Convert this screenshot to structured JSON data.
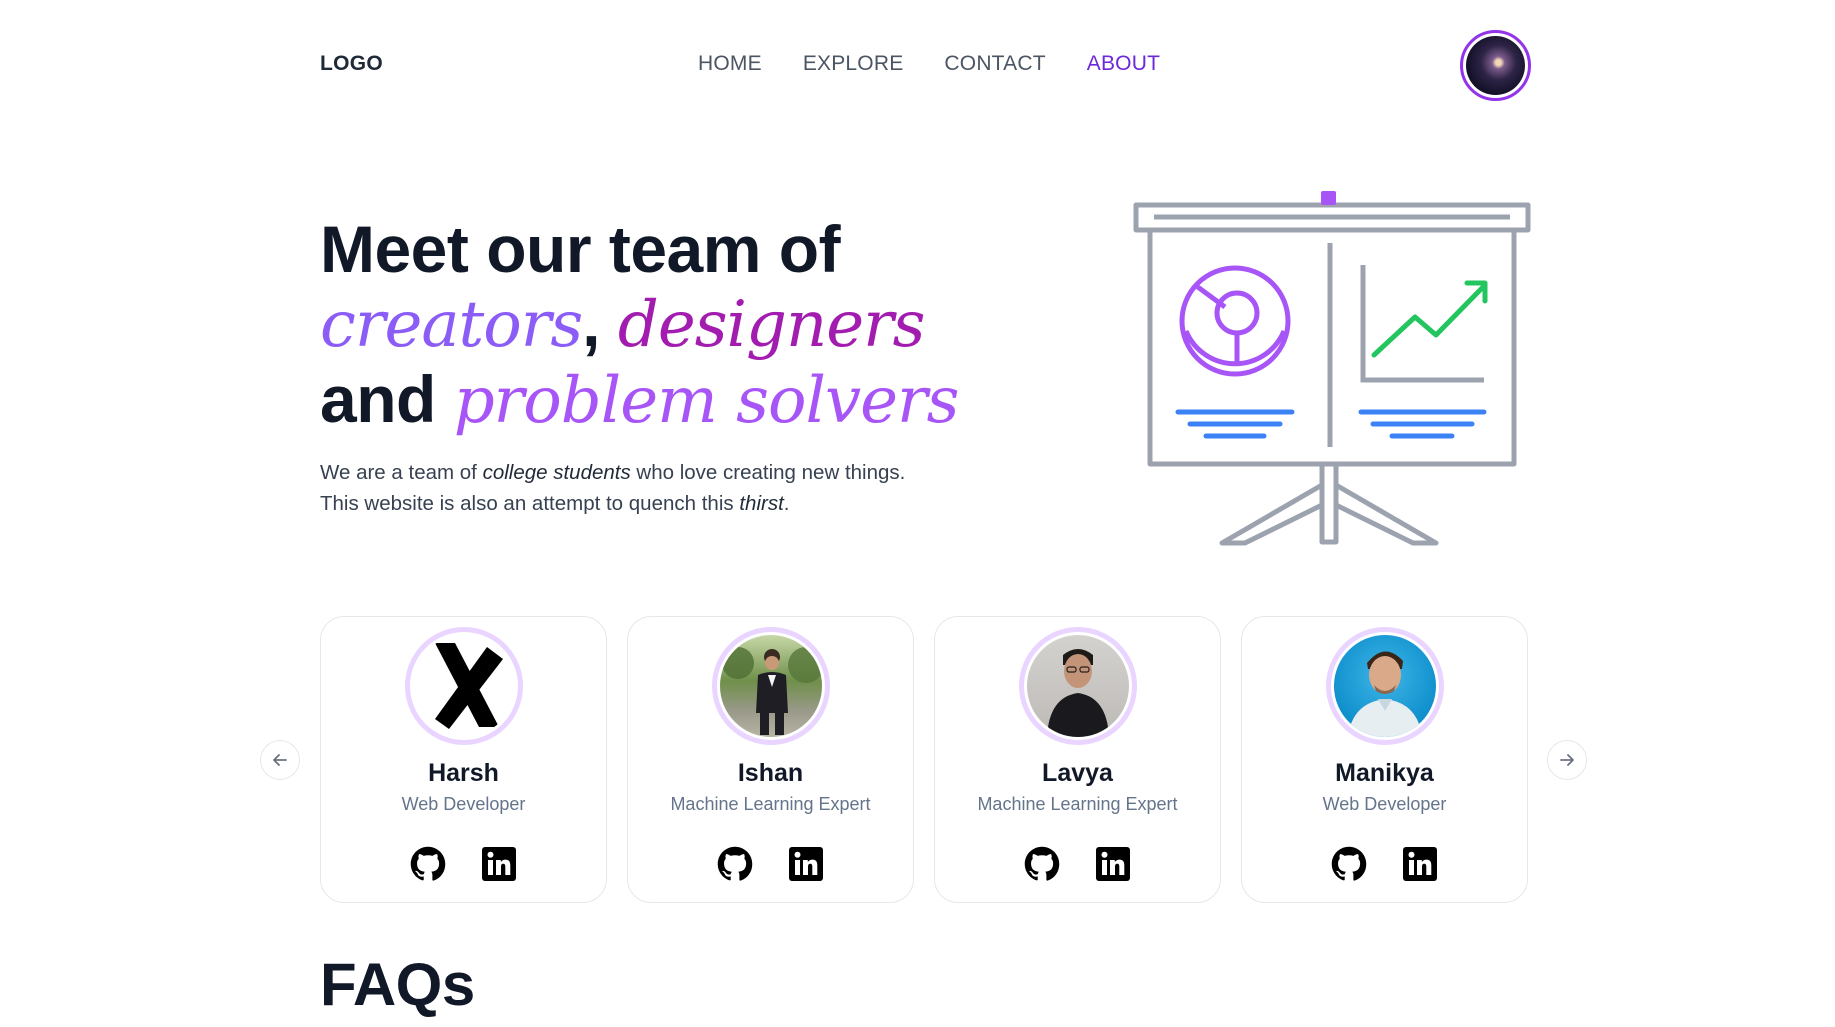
{
  "nav": {
    "logo": "LOGO",
    "links": [
      {
        "label": "HOME"
      },
      {
        "label": "EXPLORE"
      },
      {
        "label": "CONTACT"
      },
      {
        "label": "ABOUT",
        "active": true
      }
    ]
  },
  "hero": {
    "title_line1": "Meet our team of",
    "word_creators": "creators",
    "comma": ",",
    "word_designers": "designers",
    "word_and": "and",
    "word_problem_solvers": "problem solvers",
    "desc_part1": "We are a team of ",
    "desc_em1": "college students",
    "desc_part2": " who love creating new things.",
    "desc_part3": "This website is also an attempt to quench this ",
    "desc_em2": "thirst",
    "desc_part4": "."
  },
  "team": {
    "prev_icon": "arrow-left-icon",
    "next_icon": "arrow-right-icon",
    "members": [
      {
        "name": "Harsh",
        "role": "Web Developer",
        "photo": "x-logo"
      },
      {
        "name": "Ishan",
        "role": "Machine Learning Expert",
        "photo": "person-outdoor"
      },
      {
        "name": "Lavya",
        "role": "Machine Learning Expert",
        "photo": "person-indoor"
      },
      {
        "name": "Manikya",
        "role": "Web Developer",
        "photo": "person-blue-bg"
      }
    ],
    "social_icons": [
      "github-icon",
      "linkedin-icon"
    ]
  },
  "faq": {
    "title": "FAQs"
  },
  "colors": {
    "accent": "#6d28d9",
    "script_creators": "#8b5cf6",
    "script_designers": "#a21caf",
    "script_problem_solvers": "#a855f7",
    "chart_green": "#22c55e",
    "chart_blue": "#3b82f6",
    "frame_gray": "#9ca3af"
  }
}
